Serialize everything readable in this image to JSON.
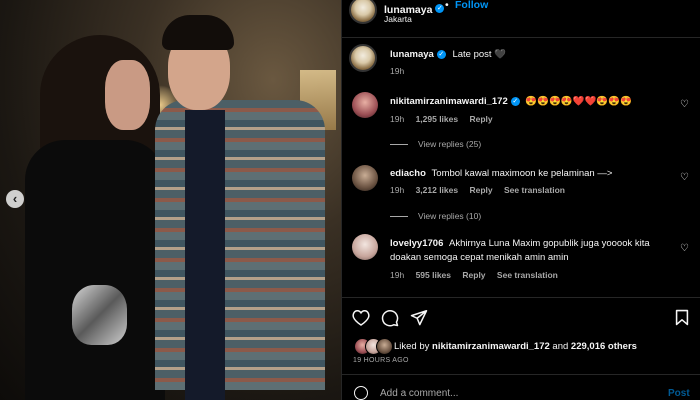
{
  "post": {
    "author": "lunamaya",
    "location": "Jakarta",
    "follow_label": "Follow",
    "dot": "•",
    "more": "•••",
    "caption": "Late post 🖤",
    "caption_time": "19h"
  },
  "comments": [
    {
      "username": "nikitamirzanimawardi_172",
      "text": "😍😍😍😍❤️❤️😍😍😍",
      "time": "19h",
      "likes": "1,295 likes",
      "reply": "Reply",
      "view_replies": "View replies (25)"
    },
    {
      "username": "ediacho",
      "text": "Tombol kawal maximoon ke pelaminan —>",
      "time": "19h",
      "likes": "3,212 likes",
      "reply": "Reply",
      "see_translation": "See translation",
      "view_replies": "View replies (10)"
    },
    {
      "username": "lovelyy1706",
      "text_line1": "Akhirnya Luna Maxim gopublik juga yooook kita",
      "text_line2": "doakan semoga cepat menikah amin amin",
      "time": "19h",
      "likes": "595 likes",
      "reply": "Reply",
      "see_translation": "See translation"
    }
  ],
  "likes": {
    "prefix": "Liked by",
    "first_liker": "nikitamirzanimawardi_172",
    "and": "and",
    "others": "229,016 others"
  },
  "timestamp": "19 HOURS AGO",
  "comment_box": {
    "placeholder": "Add a comment...",
    "post_label": "Post"
  },
  "icons": {
    "prev": "chevron-left-icon",
    "like": "heart-icon",
    "comment": "comment-icon",
    "share": "share-icon",
    "save": "bookmark-icon",
    "emoji": "emoji-icon"
  },
  "colors": {
    "accent": "#0095f6",
    "background": "#000000",
    "secondary_text": "#a8a8a8"
  }
}
